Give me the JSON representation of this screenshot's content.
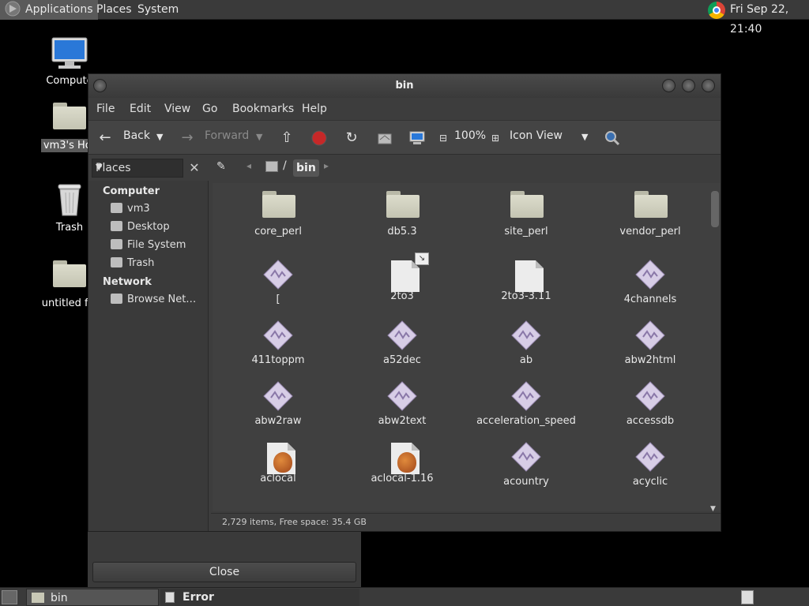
{
  "top_panel": {
    "applications": "Applications",
    "places": "Places",
    "system": "System",
    "clock": "Fri Sep 22, 21:40"
  },
  "desktop": {
    "icons": [
      {
        "label": "Compute"
      },
      {
        "label": "vm3's Hor"
      },
      {
        "label": "Trash"
      },
      {
        "label": "untitled fol"
      }
    ]
  },
  "window": {
    "title": "bin",
    "menu": [
      "File",
      "Edit",
      "View",
      "Go",
      "Bookmarks",
      "Help"
    ],
    "toolbar": {
      "back": "Back",
      "forward": "Forward",
      "zoom": "100%",
      "view_mode": "Icon View"
    },
    "places_label": "Places",
    "path": {
      "current": "bin",
      "separator": "/"
    },
    "sidebar": {
      "computer_header": "Computer",
      "computer_items": [
        "vm3",
        "Desktop",
        "File System",
        "Trash"
      ],
      "network_header": "Network",
      "network_items": [
        "Browse Net…"
      ]
    },
    "files": [
      {
        "name": "core_perl",
        "type": "folder"
      },
      {
        "name": "db5.3",
        "type": "folder"
      },
      {
        "name": "site_perl",
        "type": "folder"
      },
      {
        "name": "vendor_perl",
        "type": "folder"
      },
      {
        "name": "[",
        "type": "exec"
      },
      {
        "name": "2to3",
        "type": "doc-link"
      },
      {
        "name": "2to3-3.11",
        "type": "doc"
      },
      {
        "name": "4channels",
        "type": "exec"
      },
      {
        "name": "411toppm",
        "type": "exec"
      },
      {
        "name": "a52dec",
        "type": "exec"
      },
      {
        "name": "ab",
        "type": "exec"
      },
      {
        "name": "abw2html",
        "type": "exec"
      },
      {
        "name": "abw2raw",
        "type": "exec"
      },
      {
        "name": "abw2text",
        "type": "exec"
      },
      {
        "name": "acceleration_speed",
        "type": "exec"
      },
      {
        "name": "accessdb",
        "type": "exec"
      },
      {
        "name": "aclocal",
        "type": "script"
      },
      {
        "name": "aclocal-1.16",
        "type": "script"
      },
      {
        "name": "acountry",
        "type": "exec"
      },
      {
        "name": "acyclic",
        "type": "exec"
      }
    ],
    "status": "2,729 items, Free space: 35.4 GB"
  },
  "dialog": {
    "close": "Close"
  },
  "taskbar": {
    "bin": "bin",
    "error": "Error"
  }
}
